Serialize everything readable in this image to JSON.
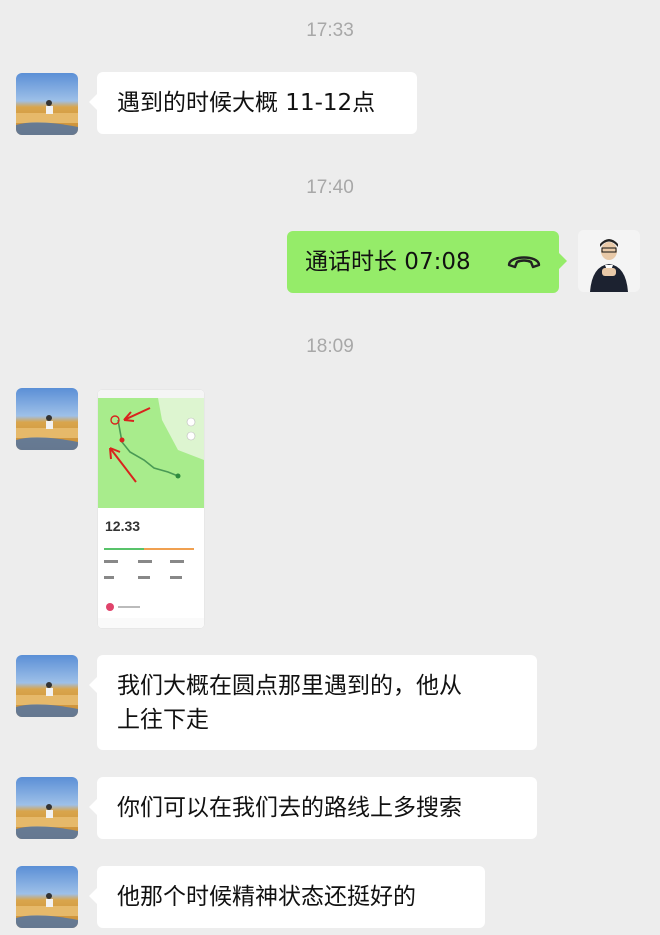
{
  "timestamps": [
    "17:33",
    "17:40",
    "18:09"
  ],
  "messages": {
    "m1": "遇到的时候大概 11-12点",
    "call_label": "通话时长 07:08",
    "m3_line1": "我们大概在圆点那里遇到的，他从",
    "m3_line2": "上往下走",
    "m4": "你们可以在我们去的路线上多搜索",
    "m5": "他那个时候精神状态还挺好的"
  },
  "thumbnail": {
    "distance": "12.33"
  },
  "colors": {
    "background": "#ededed",
    "bubble_left": "#ffffff",
    "bubble_right": "#95ec69",
    "timestamp": "#a8a8a8",
    "map_green": "#a8ec8c",
    "arrow_red": "#d9231d"
  },
  "icons": [
    "phone-hangup-icon",
    "red-arrow-icon"
  ]
}
